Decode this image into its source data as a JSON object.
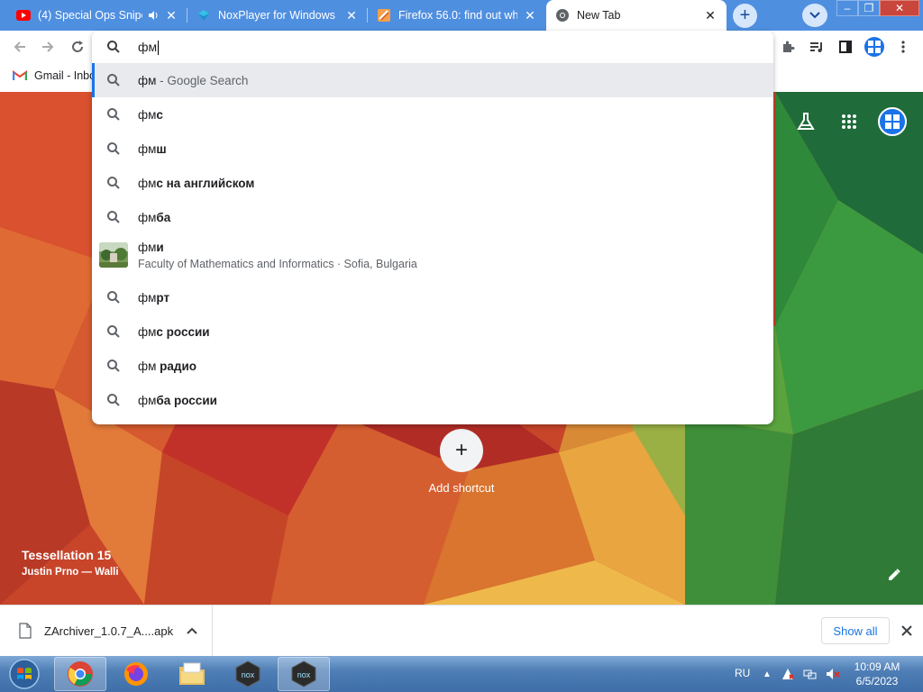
{
  "tabs": [
    {
      "title": "(4) Special Ops Snipe",
      "icon": "youtube-icon",
      "has_audio": true
    },
    {
      "title": "NoxPlayer for Windows -",
      "icon": "noxplayer-icon"
    },
    {
      "title": "Firefox 56.0: find out wha",
      "icon": "firefox-doc-icon"
    },
    {
      "title": "New Tab",
      "icon": "chrome-icon",
      "active": true
    }
  ],
  "omnibox": {
    "query": "фм",
    "suggestions": [
      {
        "prefix": "фм",
        "suffix": "",
        "extra": " - Google Search",
        "selected": true
      },
      {
        "prefix": "фм",
        "suffix": "с"
      },
      {
        "prefix": "фм",
        "suffix": "ш"
      },
      {
        "prefix": "фм",
        "suffix": "с на английском"
      },
      {
        "prefix": "фм",
        "suffix": "ба"
      },
      {
        "prefix": "фм",
        "suffix": "и",
        "entity": true,
        "subtitle": "Faculty of Mathematics and Informatics · Sofia, Bulgaria"
      },
      {
        "prefix": "фм",
        "suffix": "рт"
      },
      {
        "prefix": "фм",
        "suffix": "с россии"
      },
      {
        "prefix": "фм",
        "suffix": " радио"
      },
      {
        "prefix": "фм",
        "suffix": "ба россии"
      }
    ]
  },
  "bookmarks": [
    {
      "label": "Gmail - Inbo",
      "icon": "gmail-icon"
    }
  ],
  "ntp": {
    "add_shortcut_label": "Add shortcut",
    "background_title": "Tessellation 15",
    "background_author": "Justin Prno — Walli"
  },
  "download_shelf": {
    "file_name": "ZArchiver_1.0.7_A....apk",
    "show_all_label": "Show all"
  },
  "taskbar": {
    "language": "RU",
    "time": "10:09 AM",
    "date": "6/5/2023",
    "apps": [
      "windows-start-icon",
      "chrome-icon",
      "firefox-icon",
      "file-explorer-icon",
      "nox-icon",
      "nox-icon"
    ]
  },
  "colors": {
    "tabbar": "#4f8fe0",
    "accent": "#1a73e8"
  }
}
